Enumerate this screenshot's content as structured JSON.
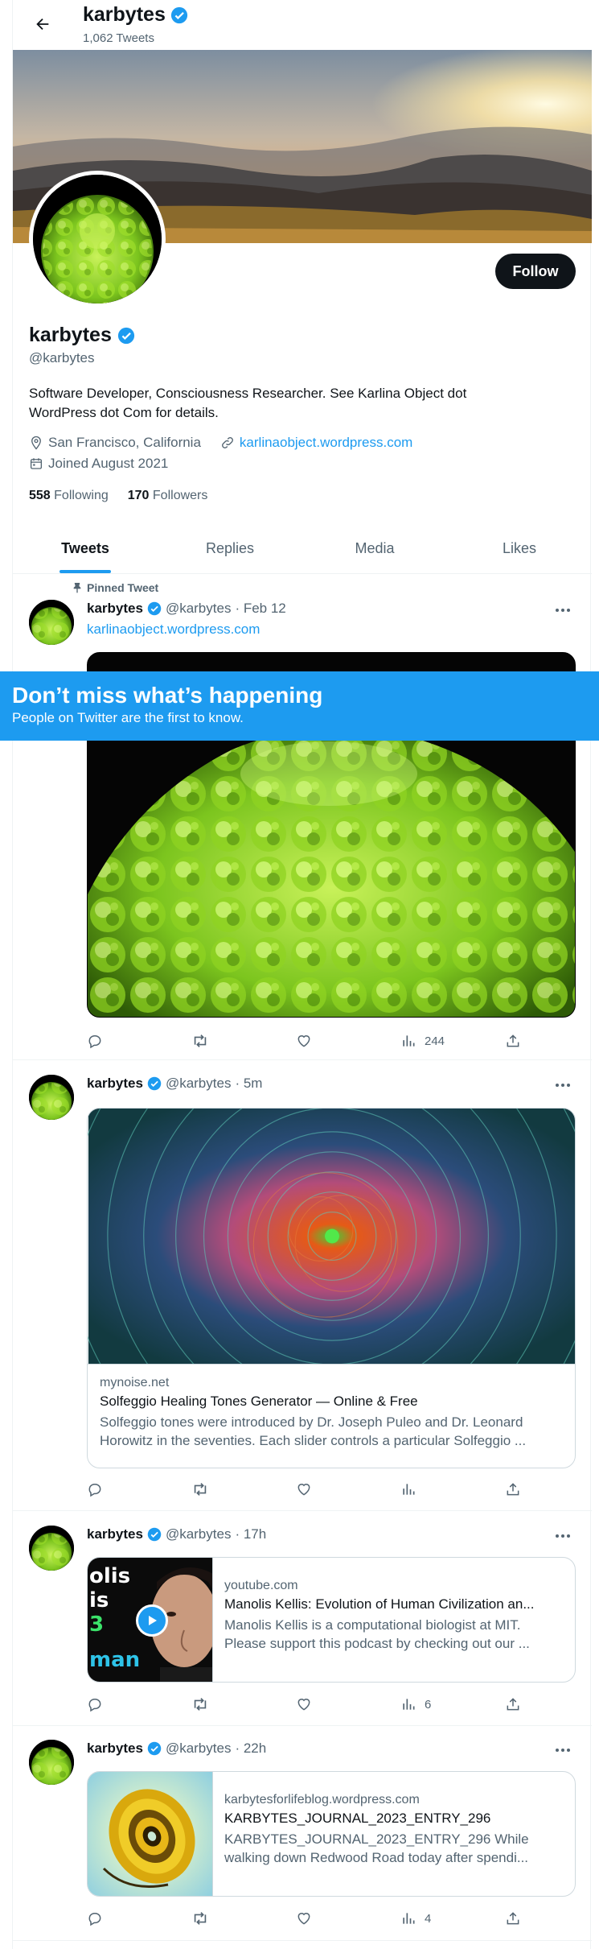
{
  "header": {
    "name": "karbytes",
    "tweet_count": "1,062 Tweets"
  },
  "profile": {
    "follow_label": "Follow",
    "name": "karbytes",
    "handle": "@karbytes",
    "bio": "Software Developer, Consciousness Researcher. See Karlina Object dot WordPress dot Com for details.",
    "location": "San Francisco, California",
    "website": "karlinaobject.wordpress.com",
    "joined": "Joined August 2021",
    "following_count": "558",
    "following_label": "Following",
    "followers_count": "170",
    "followers_label": "Followers"
  },
  "tabs": [
    "Tweets",
    "Replies",
    "Media",
    "Likes"
  ],
  "tweets": [
    {
      "pinned_label": "Pinned Tweet",
      "name": "karbytes",
      "handle": "@karbytes",
      "time": "· Feb 12",
      "text": "karlinaobject.wordpress.com",
      "views": "244"
    },
    {
      "name": "karbytes",
      "handle": "@karbytes",
      "time": "· 5m",
      "card": {
        "domain": "mynoise.net",
        "title": "Solfeggio Healing Tones Generator — Online & Free",
        "desc": "Solfeggio tones were introduced by Dr. Joseph Puleo and Dr. Leonard Horowitz in the seventies. Each slider controls a particular Solfeggio ..."
      },
      "views": ""
    },
    {
      "name": "karbytes",
      "handle": "@karbytes",
      "time": "· 17h",
      "card": {
        "domain": "youtube.com",
        "title": "Manolis Kellis: Evolution of Human Civilization an...",
        "desc1": "Manolis Kellis is a computational biologist at MIT.",
        "desc2": "Please support this podcast by checking out our ...",
        "thumb_text": [
          "olis",
          "is",
          "3",
          "man"
        ]
      },
      "views": "6"
    },
    {
      "name": "karbytes",
      "handle": "@karbytes",
      "time": "· 22h",
      "card": {
        "domain": "karbytesforlifeblog.wordpress.com",
        "title": "KARBYTES_JOURNAL_2023_ENTRY_296",
        "desc1": "KARBYTES_JOURNAL_2023_ENTRY_296 While",
        "desc2": "walking down Redwood Road today after spendi..."
      },
      "views": "4"
    }
  ],
  "overlay": {
    "title": "Don’t miss what’s happening",
    "subtitle": "People on Twitter are the first to know."
  },
  "colors": {
    "accent": "#1d9bf0",
    "text": "#0f1419",
    "muted": "#536471"
  }
}
